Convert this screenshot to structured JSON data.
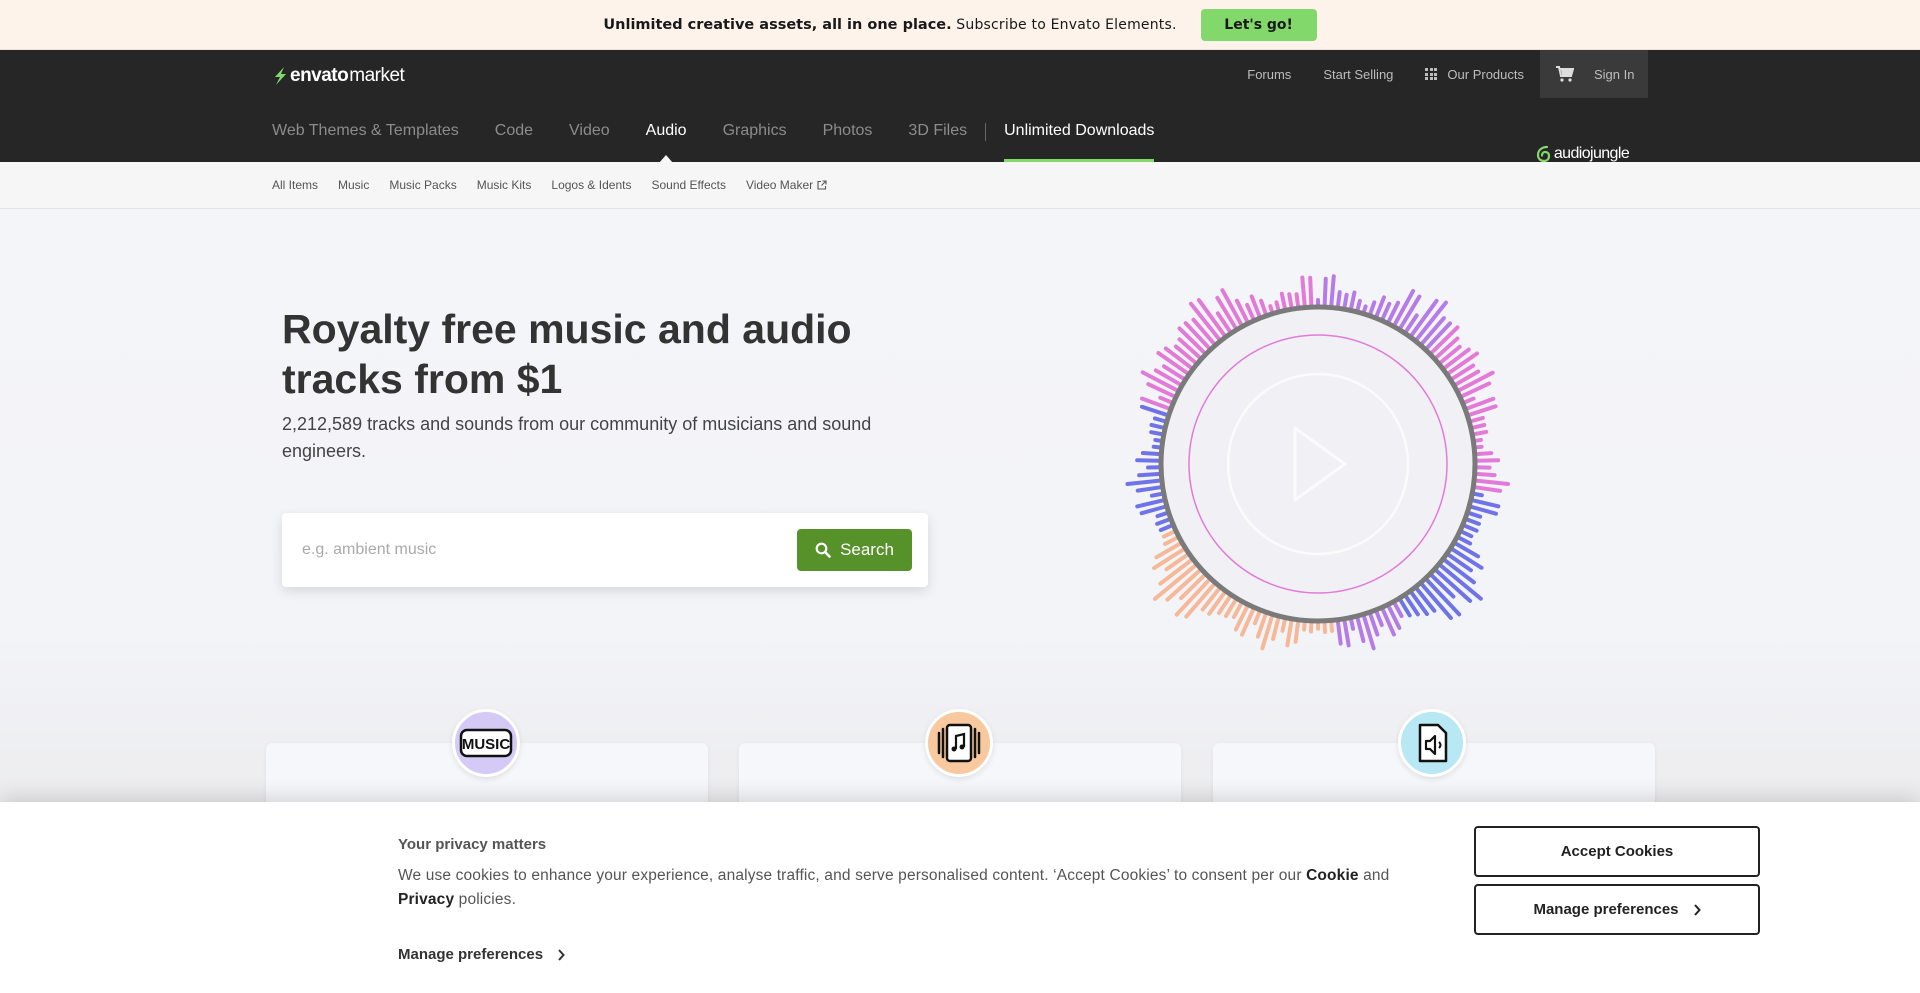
{
  "promo": {
    "strong": "Unlimited creative assets, all in one place.",
    "light": " Subscribe to Envato Elements.",
    "button": "Let's go!"
  },
  "header": {
    "logo_bold": "envato",
    "logo_light": "market",
    "links": [
      "Forums",
      "Start Selling",
      "Our Products",
      "Sign In"
    ],
    "categories": [
      "Web Themes & Templates",
      "Code",
      "Video",
      "Audio",
      "Graphics",
      "Photos",
      "3D Files"
    ],
    "unlimited": "Unlimited Downloads",
    "active_category": "Audio",
    "site_badge": "audiojungle"
  },
  "subnav": [
    "All Items",
    "Music",
    "Music Packs",
    "Music Kits",
    "Logos & Idents",
    "Sound Effects",
    "Video Maker"
  ],
  "hero": {
    "title": "Royalty free music and audio tracks from $1",
    "subtitle": "2,212,589 tracks and sounds from our community of musicians and sound engineers.",
    "search_placeholder": "e.g. ambient music",
    "search_button": "Search",
    "colors": {
      "purple": "#b57be6",
      "pink": "#e27ad8",
      "blue": "#6f73e8",
      "peach": "#f5b898",
      "green": "#57912a",
      "accent": "#82d86a"
    }
  },
  "cards": [
    {
      "icon": "music-text-icon",
      "icon_text": "MUSIC"
    },
    {
      "icon": "music-pack-icon"
    },
    {
      "icon": "sound-file-icon"
    }
  ],
  "cookie": {
    "title": "Your privacy matters",
    "body_pre": "We use cookies to enhance your experience, analyse traffic, and serve personalised content. ‘Accept Cookies’ to consent per our ",
    "cookie_word": "Cookie",
    "and": " and ",
    "privacy_word": "Privacy",
    "body_post": " policies.",
    "manage_link": "Manage preferences",
    "accept_button": "Accept Cookies",
    "manage_button": "Manage preferences"
  }
}
